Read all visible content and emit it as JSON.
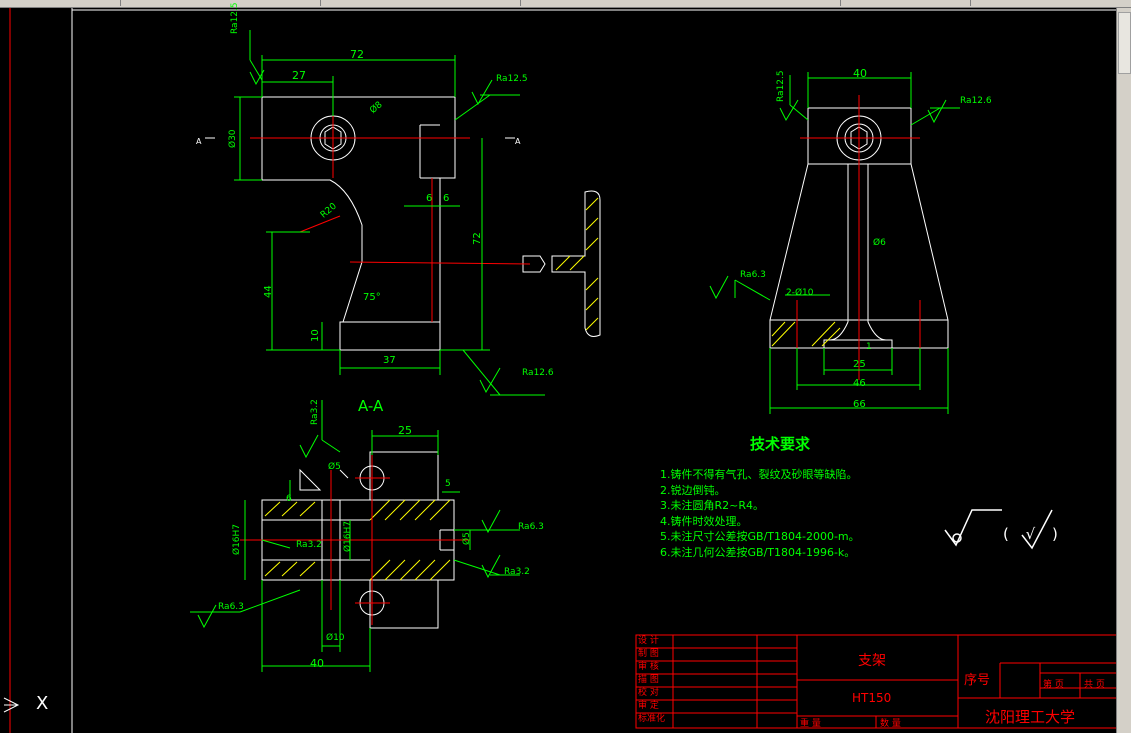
{
  "drawing": {
    "front_view": {
      "dims": [
        "72",
        "27",
        "Ra12.5",
        "Ra12.5",
        "Ø8",
        "Ø30",
        "R20",
        "6",
        "6",
        "72",
        "44",
        "10",
        "75°",
        "37",
        "Ra12.6"
      ],
      "section_marks": [
        "A",
        "A"
      ]
    },
    "side_view": {
      "dims": [
        "40",
        "Ra12.5",
        "Ra12.6",
        "Ø6",
        "Ra6.3",
        "2-Ø10",
        "25",
        "46",
        "66",
        "1"
      ]
    },
    "section_view": {
      "title": "A-A",
      "dims": [
        "Ra3.2",
        "25",
        "Ø5",
        "5",
        "6",
        "Ø16H7",
        "Ø16H7",
        "Ra3.2",
        "Ra6.3",
        "Ø5",
        "Ra3.2",
        "Ra6.3",
        "Ø10",
        "40"
      ]
    },
    "tech_requirements": {
      "title": "技术要求",
      "items": [
        "1.铸件不得有气孔、裂纹及砂眼等缺陷。",
        "2.锐边倒钝。",
        "3.未注圆角R2~R4。",
        "4.铸件时效处理。",
        "5.未注尺寸公差按GB/T1804-2000-m。",
        "6.未注几何公差按GB/T1804-1996-k。"
      ],
      "roughness_note": "( √ )"
    },
    "title_block": {
      "part_name": "支架",
      "material": "HT150",
      "school": "沈阳理工大学",
      "seq_label": "序号",
      "sheet_labels": [
        "第 页",
        "共 页"
      ],
      "left_rows": [
        "设 计",
        "制 图",
        "审 核",
        "描 图",
        "校 对",
        "审 定",
        "标准化"
      ],
      "weight_label": "重 量",
      "qty_label": "数 量"
    },
    "ucs_label": "X"
  },
  "colors": {
    "background": "#000000",
    "outline": "#ffffff",
    "dimension": "#00ff00",
    "center": "#ff0000",
    "hatch": "#ffff00",
    "text_green": "#00ff00",
    "title_red": "#ff0000"
  }
}
